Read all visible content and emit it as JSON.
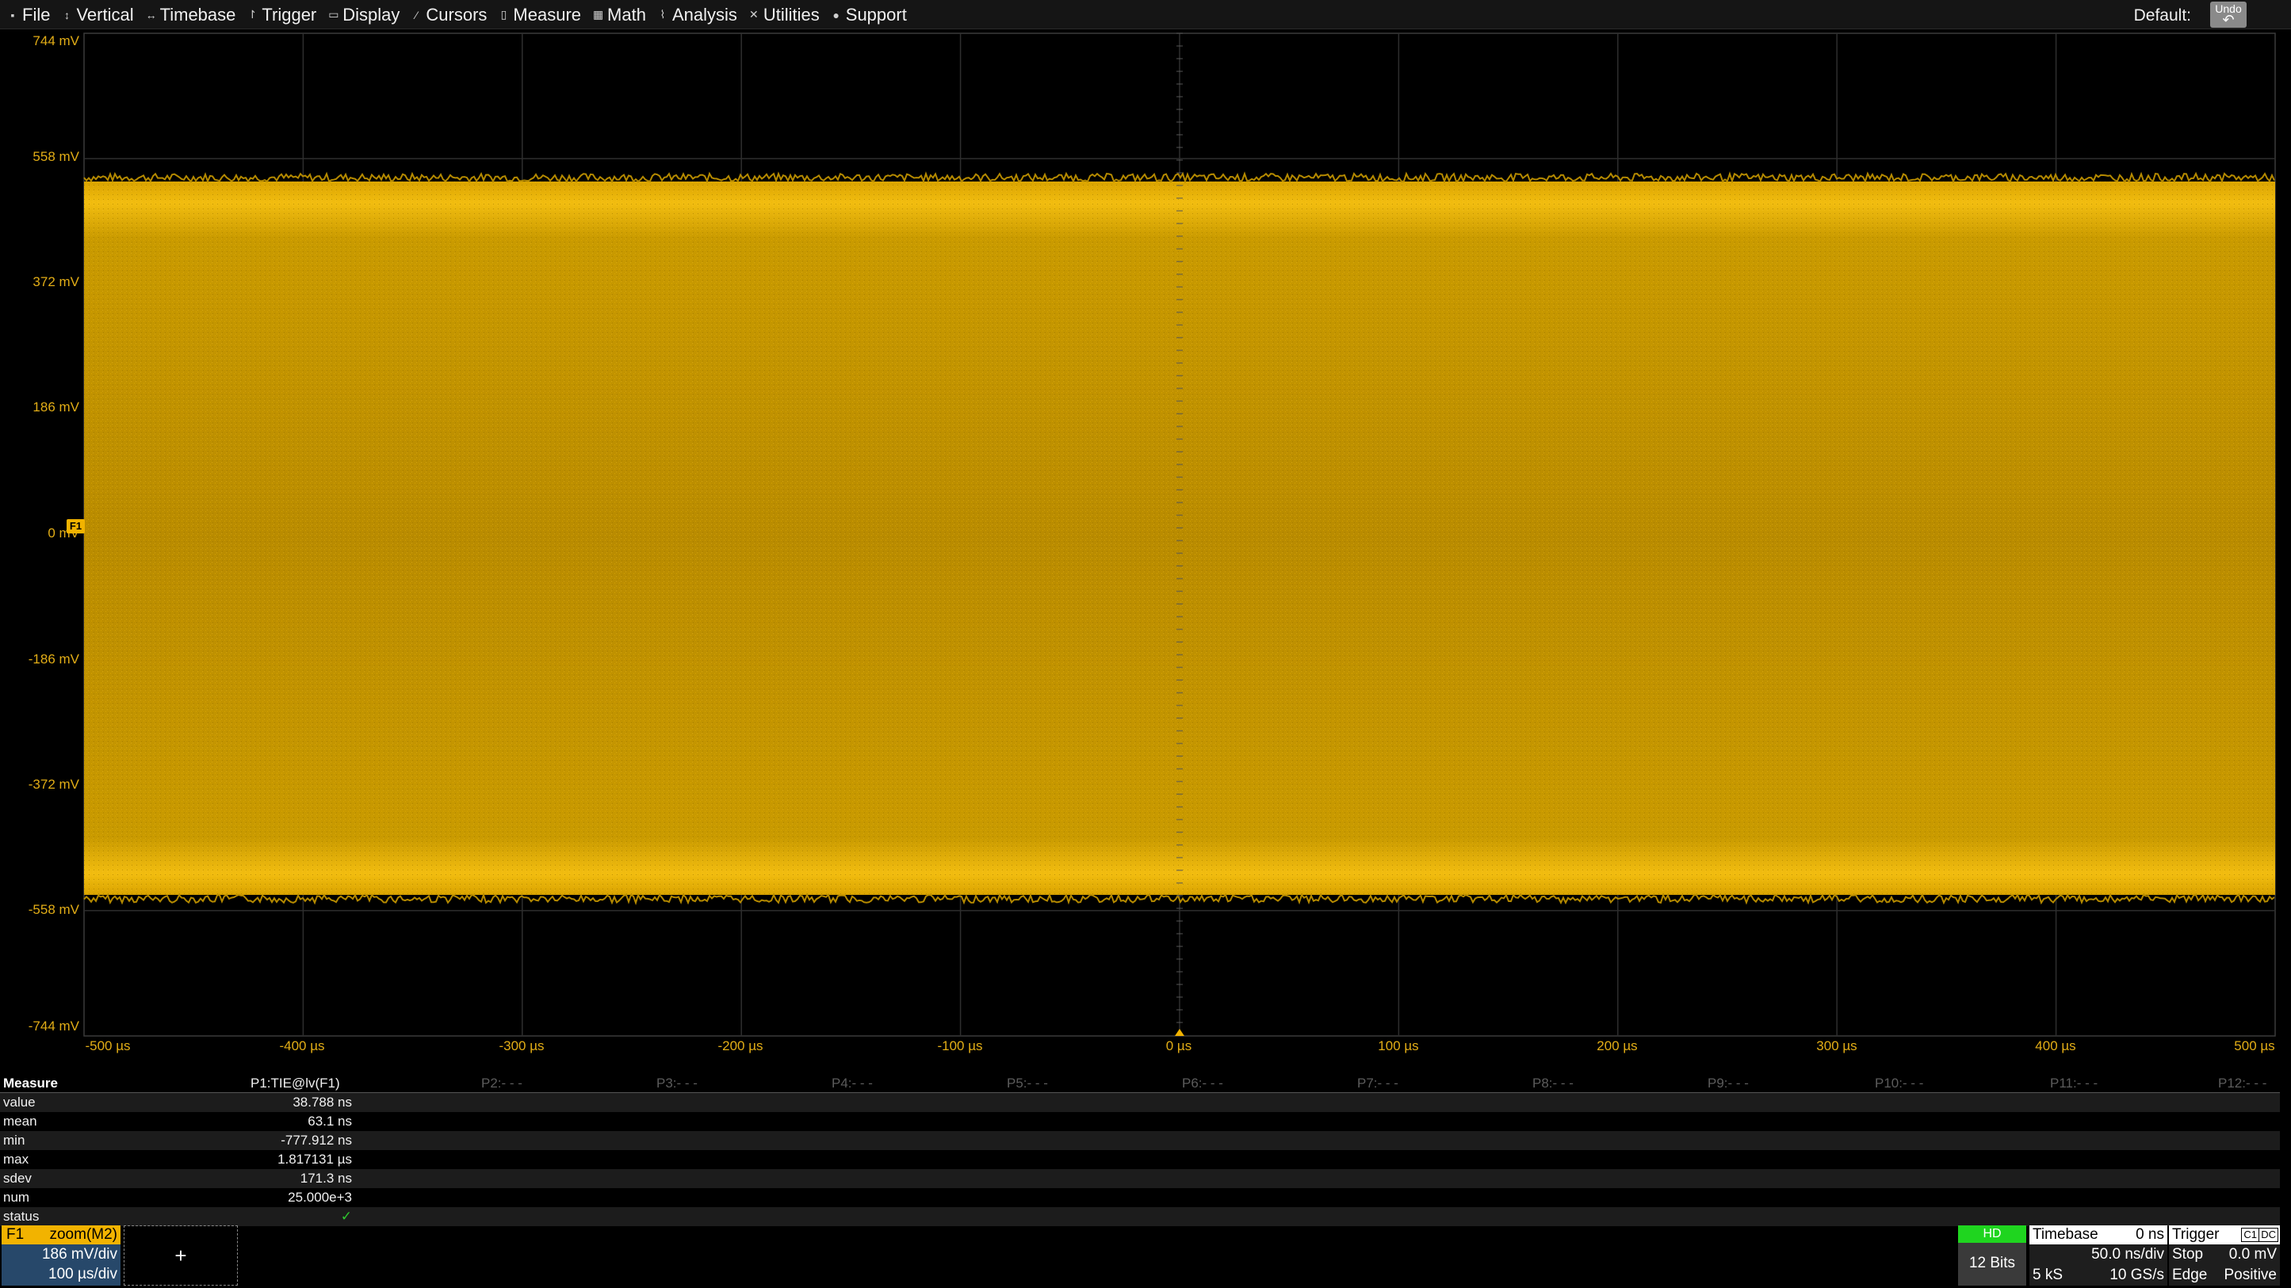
{
  "menu": [
    {
      "label": "File",
      "icon": "file-icon"
    },
    {
      "label": "Vertical",
      "icon": "vertical-icon"
    },
    {
      "label": "Timebase",
      "icon": "timebase-icon"
    },
    {
      "label": "Trigger",
      "icon": "trigger-icon"
    },
    {
      "label": "Display",
      "icon": "display-icon"
    },
    {
      "label": "Cursors",
      "icon": "cursors-icon"
    },
    {
      "label": "Measure",
      "icon": "measure-icon"
    },
    {
      "label": "Math",
      "icon": "math-icon"
    },
    {
      "label": "Analysis",
      "icon": "analysis-icon"
    },
    {
      "label": "Utilities",
      "icon": "utilities-icon"
    },
    {
      "label": "Support",
      "icon": "support-icon"
    }
  ],
  "toolbar": {
    "default_label": "Default:",
    "undo_label": "Undo"
  },
  "grid": {
    "y_labels": [
      "744 mV",
      "558 mV",
      "372 mV",
      "186 mV",
      "0 mV",
      "-186 mV",
      "-372 mV",
      "-558 mV",
      "-744 mV"
    ],
    "x_labels": [
      "-500 µs",
      "-400 µs",
      "-300 µs",
      "-200 µs",
      "-100 µs",
      "0 µs",
      "100 µs",
      "200 µs",
      "300 µs",
      "400 µs",
      "500 µs"
    ],
    "trace_marker": "F1",
    "trace_color": "#c89600"
  },
  "measure": {
    "header_label": "Measure",
    "params": [
      "P1:TIE@lv(F1)",
      "P2:- - -",
      "P3:- - -",
      "P4:- - -",
      "P5:- - -",
      "P6:- - -",
      "P7:- - -",
      "P8:- - -",
      "P9:- - -",
      "P10:- - -",
      "P11:- - -",
      "P12:- - -"
    ],
    "rows": [
      {
        "label": "value",
        "value": "38.788 ns"
      },
      {
        "label": "mean",
        "value": "63.1 ns"
      },
      {
        "label": "min",
        "value": "-777.912 ns"
      },
      {
        "label": "max",
        "value": "1.817131 µs"
      },
      {
        "label": "sdev",
        "value": "171.3 ns"
      },
      {
        "label": "num",
        "value": "25.000e+3"
      },
      {
        "label": "status",
        "value": "✓"
      }
    ]
  },
  "descriptor_f1": {
    "name": "F1",
    "source": "zoom(M2)",
    "vdiv": "186 mV/div",
    "tdiv": "100 µs/div"
  },
  "add_button": "+",
  "hd": {
    "flag": "HD",
    "bits": "12 Bits"
  },
  "timebase": {
    "title": "Timebase",
    "delay": "0 ns",
    "rate": "50.0 ns/div",
    "samples": "5 kS",
    "srate": "10 GS/s"
  },
  "trigger": {
    "title": "Trigger",
    "source": "C1",
    "coupling": "DC",
    "mode": "Stop",
    "level": "0.0 mV",
    "type": "Edge",
    "slope": "Positive"
  }
}
